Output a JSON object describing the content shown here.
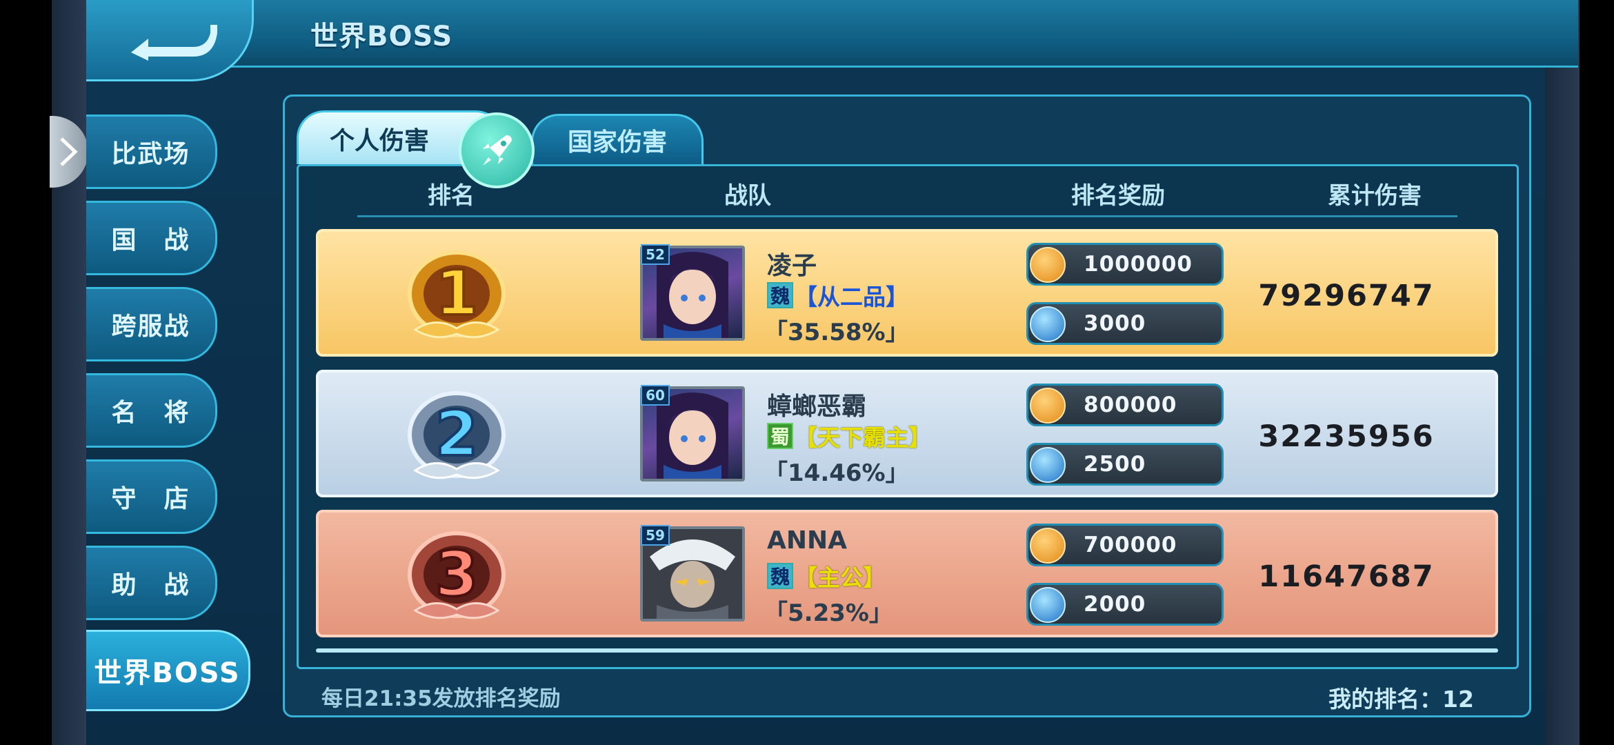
{
  "header": {
    "title": "世界BOSS"
  },
  "nav": {
    "items": [
      {
        "label": "比武场"
      },
      {
        "label": "国　战"
      },
      {
        "label": "跨服战"
      },
      {
        "label": "名　将"
      },
      {
        "label": "守　店"
      },
      {
        "label": "助　战"
      },
      {
        "label": "世界BOSS"
      }
    ]
  },
  "tabs": [
    {
      "label": "个人伤害",
      "active": true
    },
    {
      "label": "国家伤害",
      "active": false
    }
  ],
  "columns": [
    "排名",
    "战队",
    "排名奖励",
    "累计伤害"
  ],
  "rows": [
    {
      "rank": "1",
      "level": "52",
      "name": "凌子",
      "faction_icon": "魏",
      "title": "【从二品】",
      "percent": "「35.58%」",
      "reward_gold": "1000000",
      "reward_orb": "3000",
      "damage": "79296747"
    },
    {
      "rank": "2",
      "level": "60",
      "name": "蟑螂恶霸",
      "faction_icon": "蜀",
      "title": "【天下霸主】",
      "percent": "「14.46%」",
      "reward_gold": "800000",
      "reward_orb": "2500",
      "damage": "32235956"
    },
    {
      "rank": "3",
      "level": "59",
      "name": "ANNA",
      "faction_icon": "魏",
      "title": "【主公】",
      "percent": "「5.23%」",
      "reward_gold": "700000",
      "reward_orb": "2000",
      "damage": "11647687"
    }
  ],
  "footer": {
    "note": "每日21:35发放排名奖励",
    "my_rank": "我的排名：12"
  },
  "colors": {
    "rank1": "#f7c664",
    "rank2": "#b9cfe3",
    "rank3": "#e4967b",
    "accent": "#37b2d6",
    "title_yellow": "#e8e000",
    "title_blue": "#1a55d8"
  }
}
